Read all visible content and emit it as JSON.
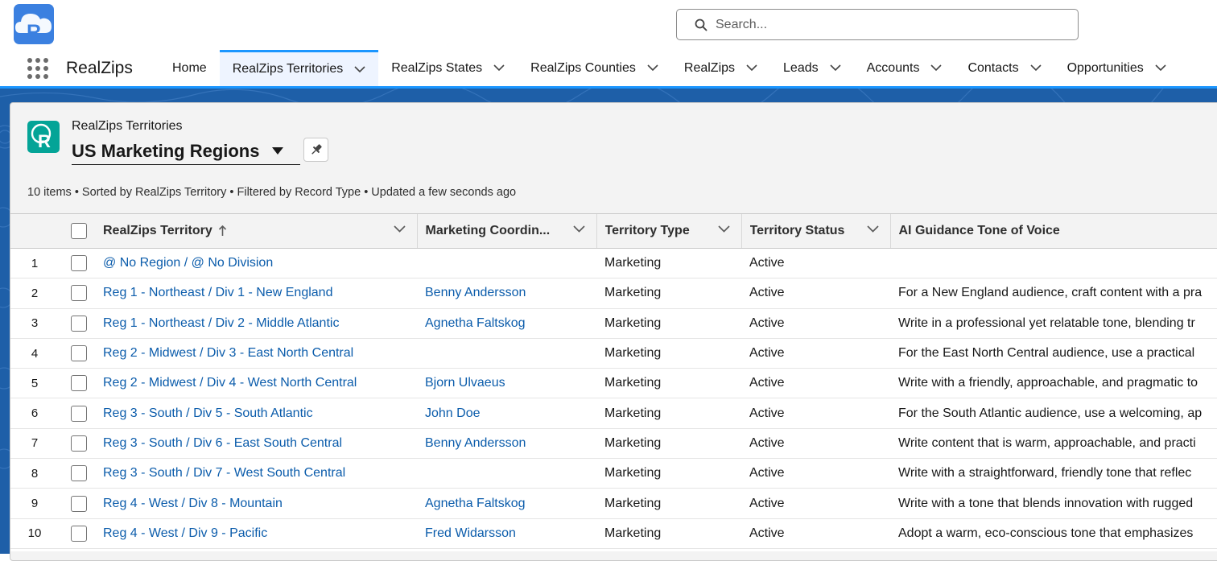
{
  "header": {
    "search_placeholder": "Search..."
  },
  "nav": {
    "app_name": "RealZips",
    "items": [
      {
        "label": "Home",
        "has_menu": false
      },
      {
        "label": "RealZips Territories",
        "has_menu": true,
        "active": true
      },
      {
        "label": "RealZips States",
        "has_menu": true
      },
      {
        "label": "RealZips Counties",
        "has_menu": true
      },
      {
        "label": "RealZips",
        "has_menu": true
      },
      {
        "label": "Leads",
        "has_menu": true
      },
      {
        "label": "Accounts",
        "has_menu": true
      },
      {
        "label": "Contacts",
        "has_menu": true
      },
      {
        "label": "Opportunities",
        "has_menu": true
      }
    ]
  },
  "list_view": {
    "object_label": "RealZips Territories",
    "title": "US Marketing Regions",
    "summary": "10 items • Sorted by RealZips Territory • Filtered by Record Type • Updated a few seconds ago"
  },
  "table": {
    "columns": {
      "name": "RealZips Territory",
      "coordinator": "Marketing Coordin...",
      "type": "Territory Type",
      "status": "Territory Status",
      "tone": "AI Guidance Tone of Voice"
    },
    "rows": [
      {
        "num": "1",
        "name": "@ No Region / @ No Division",
        "coordinator": "",
        "type": "Marketing",
        "status": "Active",
        "tone": ""
      },
      {
        "num": "2",
        "name": "Reg 1 - Northeast / Div 1 - New England",
        "coordinator": "Benny Andersson",
        "type": "Marketing",
        "status": "Active",
        "tone": "For a New England audience, craft content with a pra"
      },
      {
        "num": "3",
        "name": "Reg 1 - Northeast / Div 2 - Middle Atlantic",
        "coordinator": "Agnetha Faltskog",
        "type": "Marketing",
        "status": "Active",
        "tone": "Write in a professional yet relatable tone, blending tr"
      },
      {
        "num": "4",
        "name": "Reg 2 - Midwest / Div 3 - East North Central",
        "coordinator": "",
        "type": "Marketing",
        "status": "Active",
        "tone": "For the East North Central audience, use a practical"
      },
      {
        "num": "5",
        "name": "Reg 2 - Midwest / Div 4 - West North Central",
        "coordinator": "Bjorn Ulvaeus",
        "type": "Marketing",
        "status": "Active",
        "tone": "Write with a friendly, approachable, and pragmatic to"
      },
      {
        "num": "6",
        "name": "Reg 3 - South / Div 5 - South Atlantic",
        "coordinator": "John Doe",
        "type": "Marketing",
        "status": "Active",
        "tone": "For the South Atlantic audience, use a welcoming, ap"
      },
      {
        "num": "7",
        "name": "Reg 3 - South / Div 6 - East South Central",
        "coordinator": "Benny Andersson",
        "type": "Marketing",
        "status": "Active",
        "tone": "Write content that is warm, approachable, and practi"
      },
      {
        "num": "8",
        "name": "Reg 3 - South / Div 7 - West South Central",
        "coordinator": "",
        "type": "Marketing",
        "status": "Active",
        "tone": "Write with a straightforward, friendly tone that reflec"
      },
      {
        "num": "9",
        "name": "Reg 4 - West / Div 8 - Mountain",
        "coordinator": "Agnetha Faltskog",
        "type": "Marketing",
        "status": "Active",
        "tone": "Write with a tone that blends innovation with rugged"
      },
      {
        "num": "10",
        "name": "Reg 4 - West / Div 9 - Pacific",
        "coordinator": "Fred Widarsson",
        "type": "Marketing",
        "status": "Active",
        "tone": "Adopt a warm, eco-conscious tone that emphasizes"
      }
    ]
  }
}
